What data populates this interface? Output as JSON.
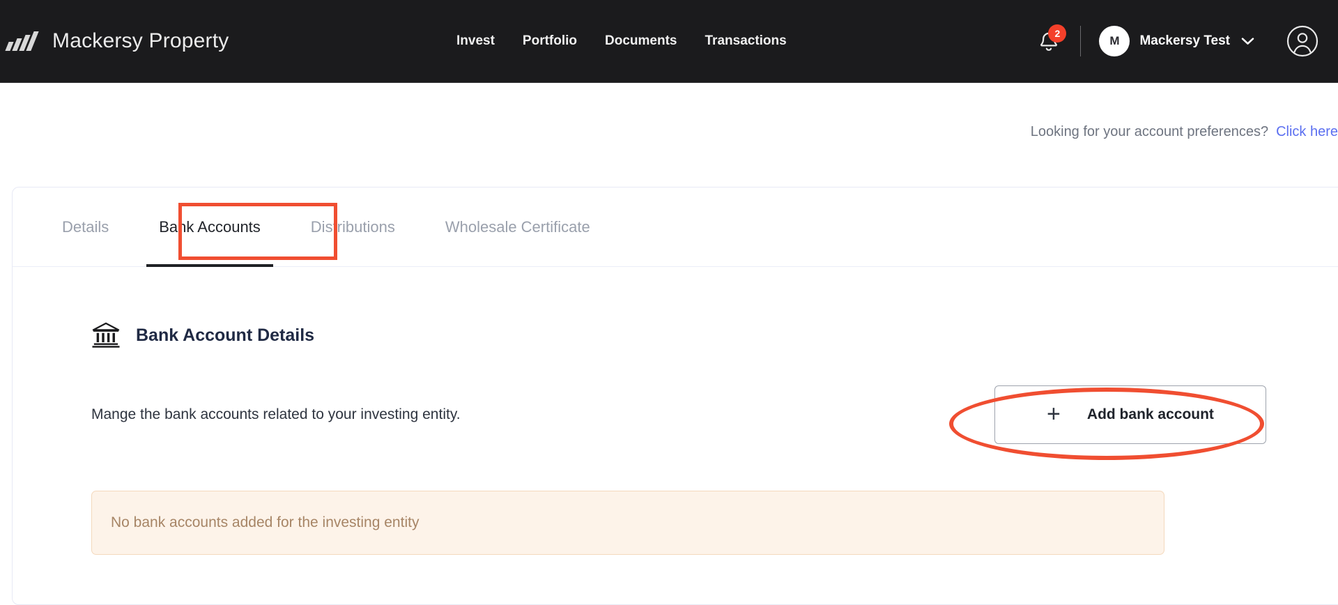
{
  "header": {
    "brand_name": "Mackersy Property",
    "brand_mark_icon": "diagonal-slashes-logo",
    "nav": [
      {
        "label": "Invest"
      },
      {
        "label": "Portfolio"
      },
      {
        "label": "Documents"
      },
      {
        "label": "Transactions"
      }
    ],
    "notifications": {
      "icon": "bell-icon",
      "count": "2",
      "badge_color": "#f4402a"
    },
    "user": {
      "avatar_initial": "M",
      "name": "Mackersy Test",
      "chevron_icon": "chevron-down-icon",
      "profile_icon": "user-circle-icon"
    }
  },
  "preferences": {
    "text": "Looking for your account preferences?",
    "link_label": "Click here",
    "link_color": "#5b6ff0"
  },
  "tabs": [
    {
      "label": "Details",
      "active": false
    },
    {
      "label": "Bank Accounts",
      "active": true
    },
    {
      "label": "Distributions",
      "active": false
    },
    {
      "label": "Wholesale Certificate",
      "active": false
    }
  ],
  "section": {
    "icon": "bank-building-icon",
    "title": "Bank Account Details",
    "description": "Mange the bank accounts related to your investing entity."
  },
  "add_button": {
    "icon": "plus-icon",
    "label": "Add bank account"
  },
  "empty_state": {
    "message": "No bank accounts added for the investing entity",
    "background_color": "#fdf3e9",
    "text_color": "#a78566"
  },
  "annotations": {
    "color": "#f04e31",
    "tab_highlight": "Bank Accounts",
    "ellipse_target": "Add bank account"
  }
}
